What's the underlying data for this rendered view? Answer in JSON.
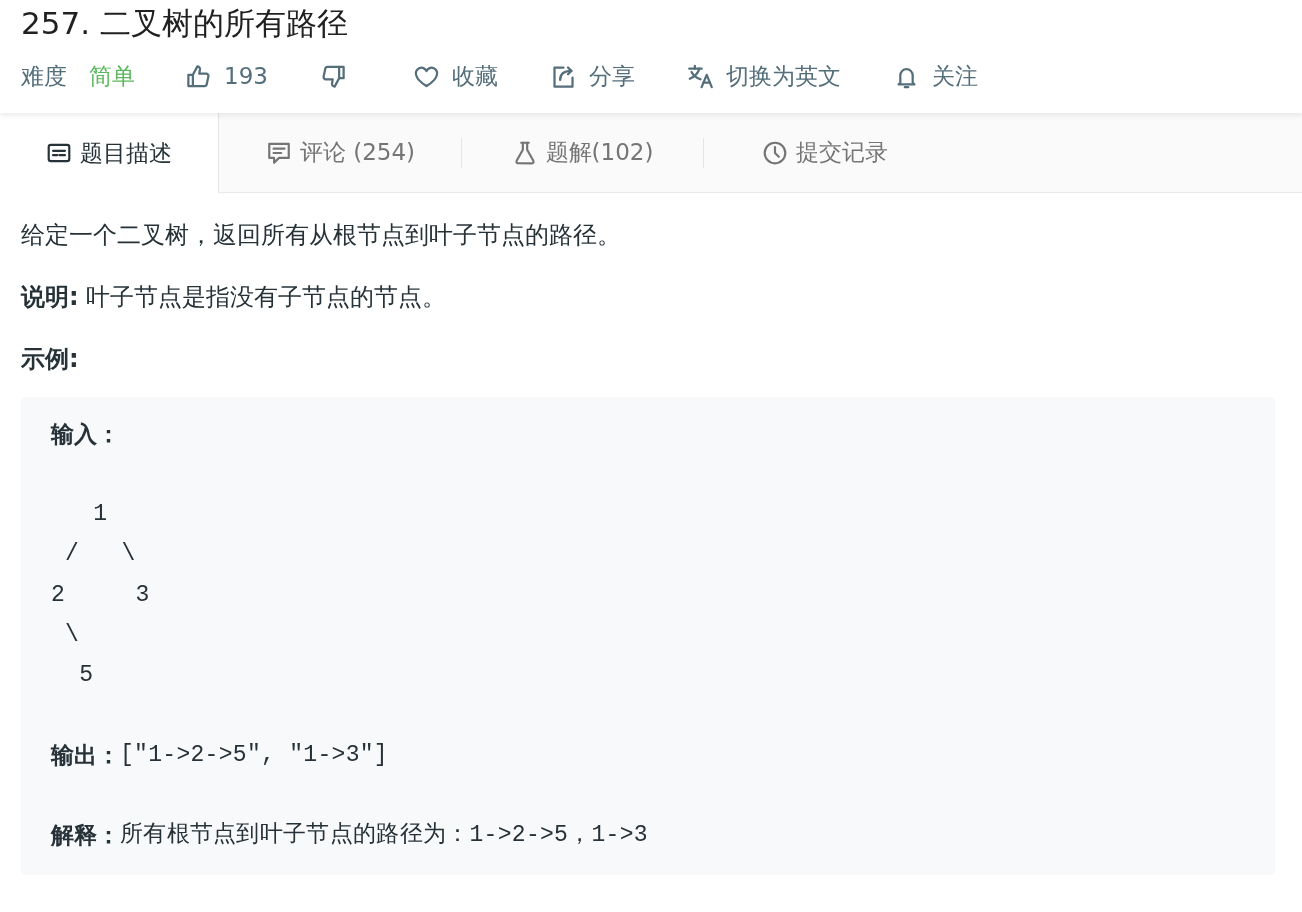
{
  "title": "257. 二叉树的所有路径",
  "meta": {
    "difficulty_label": "难度",
    "difficulty": {
      "text": "简单",
      "kind": "easy"
    },
    "actions": [
      {
        "kind": "like",
        "label": "193"
      },
      {
        "kind": "dislike"
      },
      {
        "kind": "favorite",
        "label": "收藏"
      },
      {
        "kind": "share",
        "label": "分享"
      },
      {
        "kind": "translate",
        "label": "切换为英文"
      },
      {
        "kind": "follow",
        "label": "关注"
      }
    ]
  },
  "tabs": [
    {
      "kind": "description",
      "label": "题目描述",
      "selected": true
    },
    {
      "kind": "comments",
      "label": "评论 (254)",
      "selected": false
    },
    {
      "kind": "solutions",
      "label": "题解(102)",
      "selected": false
    },
    {
      "kind": "submissions",
      "label": "提交记录",
      "selected": false
    }
  ],
  "description": {
    "paragraphs": [
      "给定一个二叉树，返回所有从根节点到叶子节点的路径。",
      "**说明:** 叶子节点是指没有子节点的节点。"
    ],
    "example_heading": "示例:"
  },
  "example": {
    "input_label": "输入：",
    "tree": "   1\n /   \\\n2     3\n \\\n  5",
    "output_label": "输出：",
    "output": "[\"1->2->5\", \"1->3\"]",
    "explanation_label": "解释：",
    "explanation": "所有根节点到叶子节点的路径为：1->2->5，1->3"
  }
}
